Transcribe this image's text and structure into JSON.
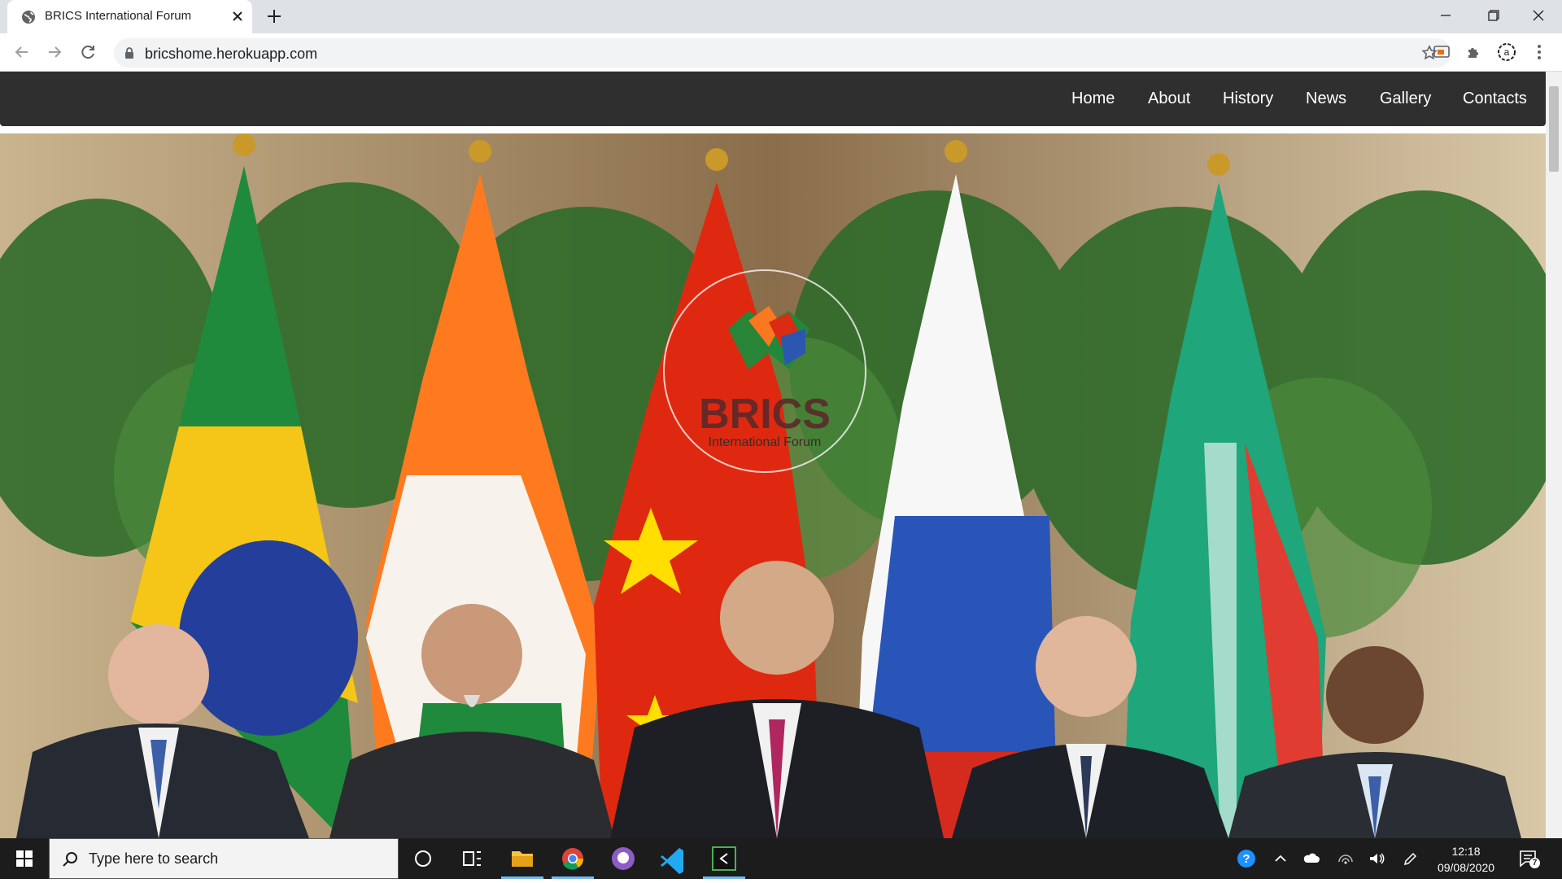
{
  "browser": {
    "tab_title": "BRICS International Forum",
    "url": "bricshome.herokuapp.com"
  },
  "nav": {
    "items": [
      "Home",
      "About",
      "History",
      "News",
      "Gallery",
      "Contacts"
    ]
  },
  "hero": {
    "logo_text": "BRICS",
    "logo_subtext": "International Forum",
    "flags": [
      "Brazil",
      "India",
      "China",
      "Russia",
      "South Africa"
    ]
  },
  "taskbar": {
    "search_placeholder": "Type here to search",
    "time": "12:18",
    "date": "09/08/2020",
    "notification_count": "7"
  },
  "colors": {
    "navbar_bg": "#2f2f2f",
    "brazil_green": "#1f8a3b",
    "india_saffron": "#ff7a1f",
    "china_red": "#de2910",
    "russia_blue": "#2a55b8",
    "sa_green": "#1fa67a"
  }
}
